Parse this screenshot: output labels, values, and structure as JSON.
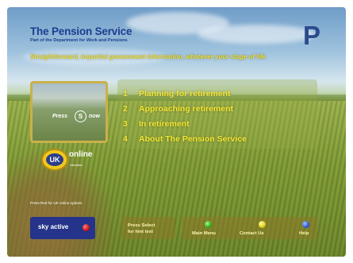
{
  "header": {
    "title": "The Pension Service",
    "subtitle": "Part of the Department for Work and Pensions",
    "tagline": "Straightforward, impartial government information, whatever your stage of life",
    "logo_letter": "P"
  },
  "menu": {
    "items": [
      {
        "number": "1",
        "label": "Planning for retirement"
      },
      {
        "number": "2",
        "label": "Approaching retirement"
      },
      {
        "number": "3",
        "label": "In retirement"
      },
      {
        "number": "4",
        "label": "About The Pension Service"
      }
    ]
  },
  "video": {
    "press_label": "Press",
    "key": "S",
    "now_label": "now"
  },
  "uk_online": {
    "badge": "UK",
    "name": "online",
    "sub": "interactive"
  },
  "red_note": "Press Red for UK online options",
  "sky": {
    "label": "sky active",
    "color": "#25348a"
  },
  "hint": {
    "text_line1": "Press Select",
    "text_line2": "for hint text"
  },
  "buttons": [
    {
      "label": "Main Menu",
      "color": "green"
    },
    {
      "label": "Contact Us",
      "color": "yellow"
    },
    {
      "label": "Help",
      "color": "blue"
    }
  ],
  "colors": {
    "accent_yellow": "#f4e638",
    "brand_blue": "#1c3f8f"
  }
}
